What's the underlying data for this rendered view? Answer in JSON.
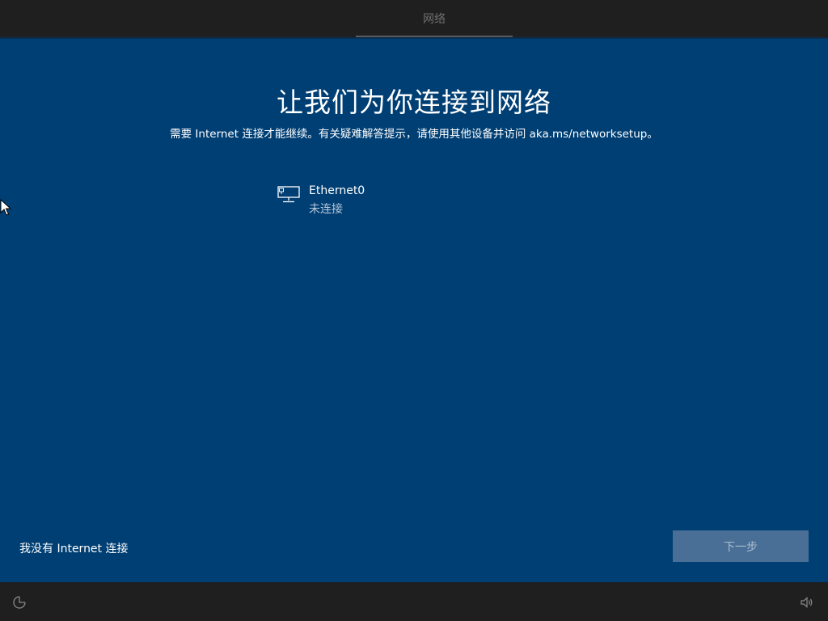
{
  "header": {
    "tab_title": "网络"
  },
  "main": {
    "title": "让我们为你连接到网络",
    "subtitle": "需要 Internet 连接才能继续。有关疑难解答提示，请使用其他设备并访问 aka.ms/networksetup。",
    "networks": [
      {
        "icon": "ethernet-icon",
        "name": "Ethernet0",
        "status": "未连接"
      }
    ],
    "no_internet_link": "我没有 Internet 连接",
    "next_button": "下一步"
  },
  "footer": {
    "left_icon": "ease-of-access-icon",
    "right_icon": "volume-icon"
  },
  "colors": {
    "background": "#003f74",
    "bar": "#1f1f1f",
    "button_disabled": "#4a6f96",
    "link": "#ffffff"
  }
}
